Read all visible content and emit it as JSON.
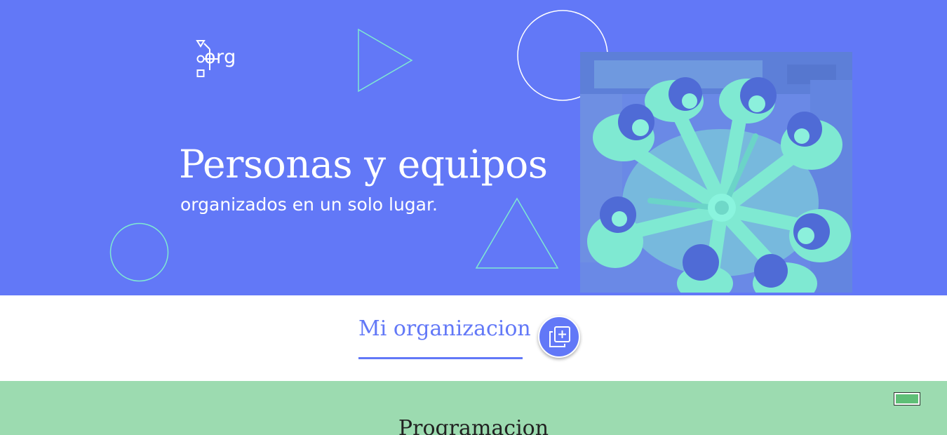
{
  "brand": {
    "logo_text": "org",
    "logo_icon": "flowchart-org-icon"
  },
  "hero": {
    "title": "Personas y equipos",
    "subtitle": "organizados en un solo lugar.",
    "photo_icon": "team-hands-together-photo"
  },
  "organization": {
    "label": "Mi organizacion",
    "add_button_icon": "add-copy-icon"
  },
  "programming": {
    "title": "Programacion"
  },
  "colors": {
    "primary": "#6278f7",
    "mint": "#7fe9d2",
    "section_green": "#9cdbb0",
    "toggle_green": "#5fbf77"
  }
}
